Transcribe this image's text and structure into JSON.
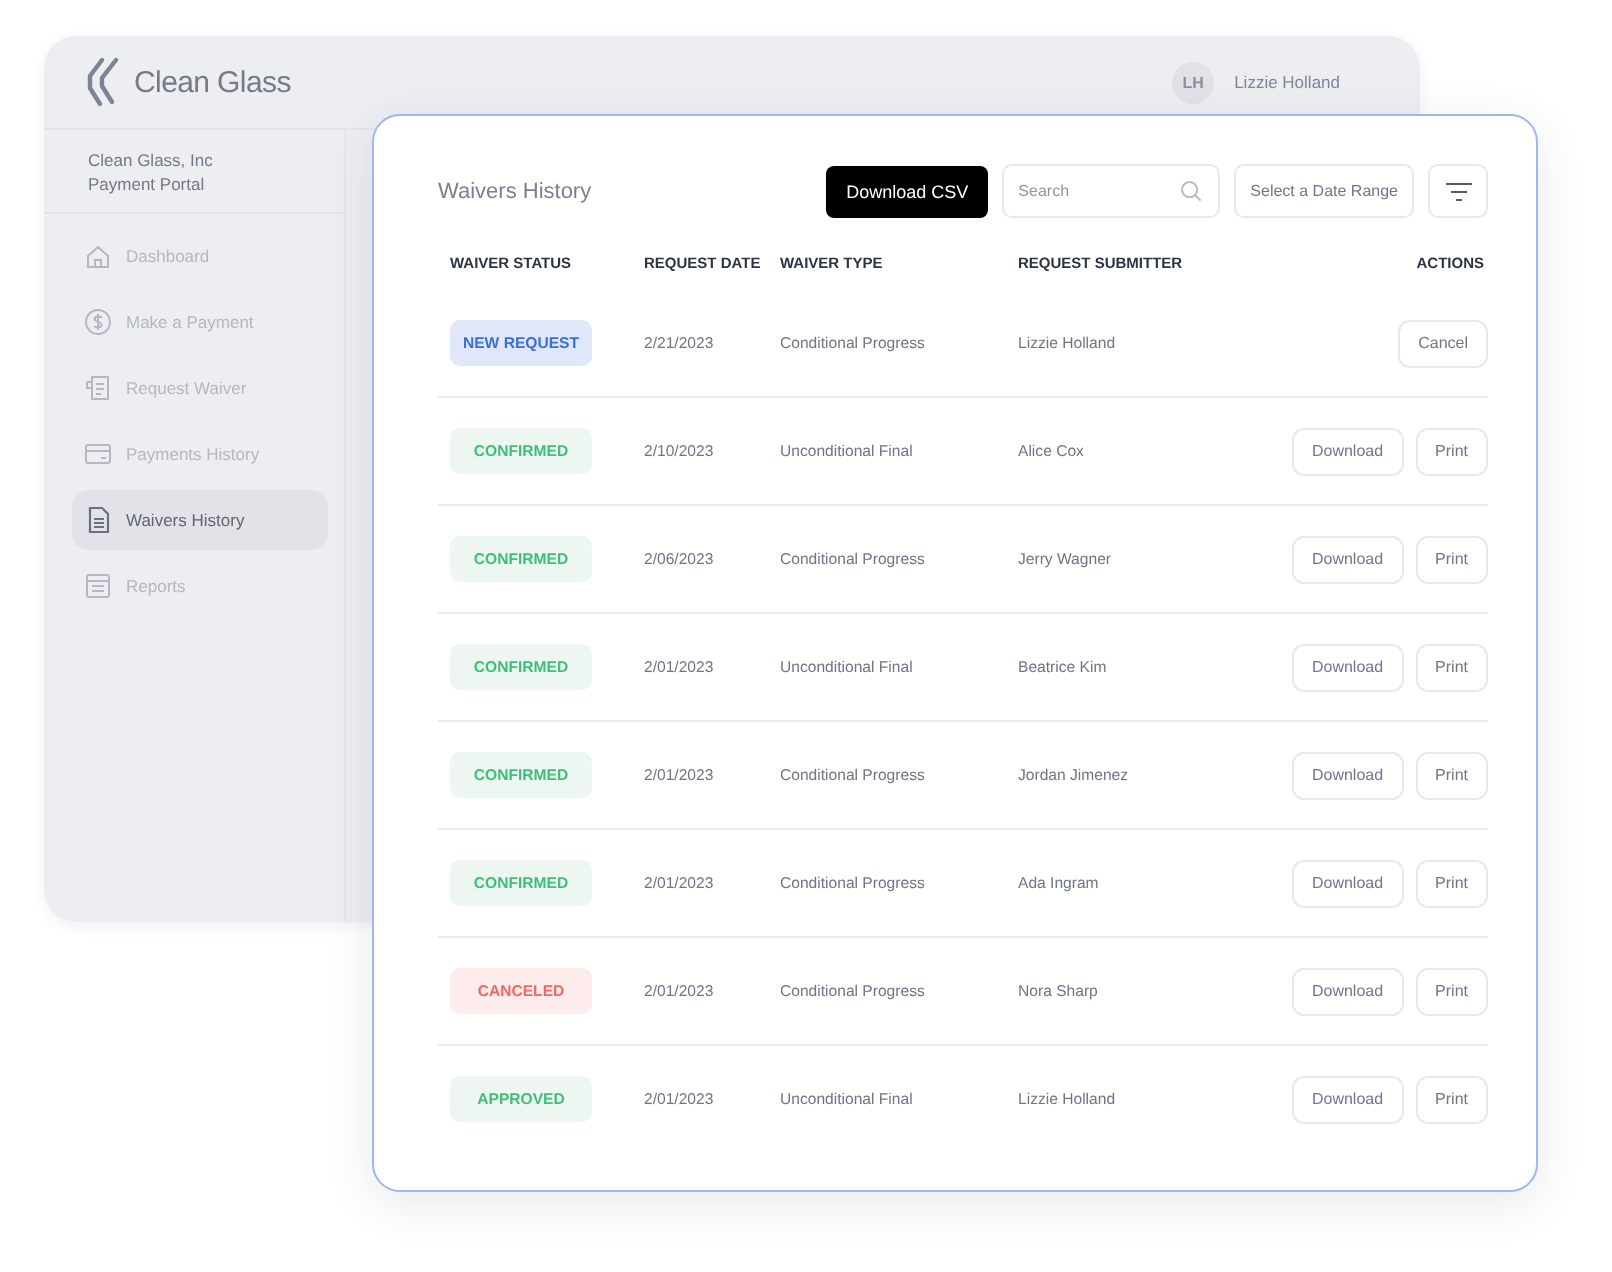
{
  "app": {
    "logo": "Clean Glass",
    "user": {
      "initials": "LH",
      "name": "Lizzie Holland"
    }
  },
  "sidebar": {
    "company": "Clean Glass, Inc",
    "portal": "Payment Portal",
    "items": [
      {
        "label": "Dashboard",
        "selected": false
      },
      {
        "label": "Make a Payment",
        "selected": false
      },
      {
        "label": "Request Waiver",
        "selected": false
      },
      {
        "label": "Payments History",
        "selected": false
      },
      {
        "label": "Waivers History",
        "selected": true
      },
      {
        "label": "Reports",
        "selected": false
      }
    ]
  },
  "panel": {
    "title": "Waivers History",
    "download_button": "Download CSV",
    "search": {
      "placeholder": "Search"
    },
    "date_range": "Select a Date Range",
    "table": {
      "columns": [
        "WAIVER STATUS",
        "REQUEST DATE",
        "WAIVER TYPE",
        "REQUEST SUBMITTER",
        "ACTIONS"
      ],
      "rows": [
        {
          "status": {
            "label": "NEW REQUEST",
            "kind": "new"
          },
          "date": "2/21/2023",
          "type": "Conditional Progress",
          "submitter": "Lizzie Holland",
          "actions": [
            "Cancel"
          ]
        },
        {
          "status": {
            "label": "CONFIRMED",
            "kind": "confirmed"
          },
          "date": "2/10/2023",
          "type": "Unconditional Final",
          "submitter": "Alice Cox",
          "actions": [
            "Download",
            "Print"
          ]
        },
        {
          "status": {
            "label": "CONFIRMED",
            "kind": "confirmed"
          },
          "date": "2/06/2023",
          "type": "Conditional Progress",
          "submitter": "Jerry Wagner",
          "actions": [
            "Download",
            "Print"
          ]
        },
        {
          "status": {
            "label": "CONFIRMED",
            "kind": "confirmed"
          },
          "date": "2/01/2023",
          "type": "Unconditional Final",
          "submitter": "Beatrice Kim",
          "actions": [
            "Download",
            "Print"
          ]
        },
        {
          "status": {
            "label": "CONFIRMED",
            "kind": "confirmed"
          },
          "date": "2/01/2023",
          "type": "Conditional Progress",
          "submitter": "Jordan Jimenez",
          "actions": [
            "Download",
            "Print"
          ]
        },
        {
          "status": {
            "label": "CONFIRMED",
            "kind": "confirmed"
          },
          "date": "2/01/2023",
          "type": "Conditional Progress",
          "submitter": "Ada Ingram",
          "actions": [
            "Download",
            "Print"
          ]
        },
        {
          "status": {
            "label": "CANCELED",
            "kind": "canceled"
          },
          "date": "2/01/2023",
          "type": "Conditional Progress",
          "submitter": "Nora Sharp",
          "actions": [
            "Download",
            "Print"
          ]
        },
        {
          "status": {
            "label": "APPROVED",
            "kind": "approved"
          },
          "date": "2/01/2023",
          "type": "Unconditional Final",
          "submitter": "Lizzie Holland",
          "actions": [
            "Download",
            "Print"
          ]
        }
      ]
    }
  }
}
